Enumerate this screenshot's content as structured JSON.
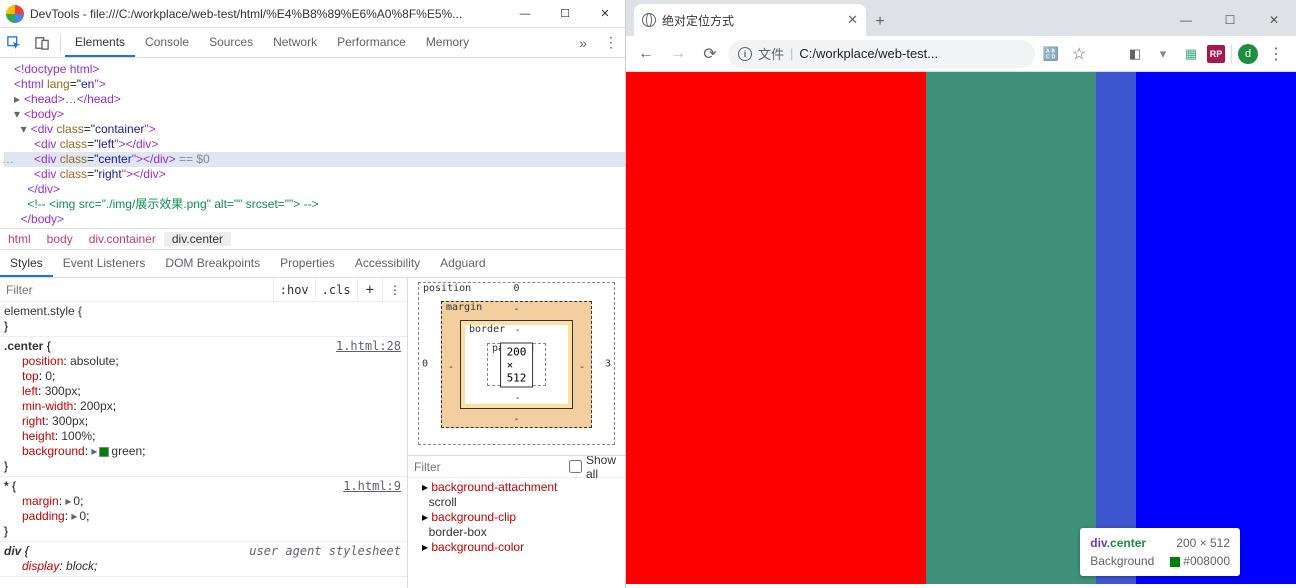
{
  "devtools": {
    "title": "DevTools - file:///C:/workplace/web-test/html/%E4%B8%89%E6%A0%8F%E5%...",
    "tabs": [
      "Elements",
      "Console",
      "Sources",
      "Network",
      "Performance",
      "Memory"
    ],
    "activeTab": "Elements",
    "dom": {
      "l0": "<!doctype html>",
      "l1a": "<",
      "l1b": "html",
      "l1c": " lang",
      "l1d": "=\"",
      "l1e": "en",
      "l1f": "\">",
      "l2a": "<",
      "l2b": "head",
      "l2c": ">…</",
      "l2d": "head",
      "l2e": ">",
      "l3a": "<",
      "l3b": "body",
      "l3c": ">",
      "l4a": "<",
      "l4b": "div",
      "l4c": " class",
      "l4d": "=\"",
      "l4e": "container",
      "l4f": "\">",
      "l5a": "<",
      "l5b": "div",
      "l5c": " class",
      "l5d": "=\"",
      "l5e": "left",
      "l5f": "\"></",
      "l5g": "div",
      "l5h": ">",
      "l6a": "<",
      "l6b": "div",
      "l6c": " class",
      "l6d": "=\"",
      "l6e": "center",
      "l6f": "\"></",
      "l6g": "div",
      "l6h": ">",
      "l6hint": " == $0",
      "l7a": "<",
      "l7b": "div",
      "l7c": " class",
      "l7d": "=\"",
      "l7e": "right",
      "l7f": "\"></",
      "l7g": "div",
      "l7h": ">",
      "l8a": "</",
      "l8b": "div",
      "l8c": ">",
      "l9": "<!-- <img src=\"./img/展示效果.png\" alt=\"\" srcset=\"\"> -->",
      "l10a": "</",
      "l10b": "body",
      "l10c": ">"
    },
    "crumbs": [
      "html",
      "body",
      "div.container",
      "div.center"
    ],
    "subtabs": [
      "Styles",
      "Event Listeners",
      "DOM Breakpoints",
      "Properties",
      "Accessibility",
      "Adguard"
    ],
    "activeSubtab": "Styles",
    "filter": {
      "placeholder": "Filter",
      "hov": ":hov",
      "cls": ".cls"
    },
    "rules": {
      "r0": {
        "sel": "element.style {",
        "close": "}"
      },
      "r1": {
        "src": "1.html:28",
        "sel": ".center",
        "open": " {",
        "p": [
          {
            "n": "position",
            "v": "absolute"
          },
          {
            "n": "top",
            "v": "0"
          },
          {
            "n": "left",
            "v": "300px"
          },
          {
            "n": "min-width",
            "v": "200px"
          },
          {
            "n": "right",
            "v": "300px"
          },
          {
            "n": "height",
            "v": "100%"
          },
          {
            "n": "background",
            "v": "green",
            "color": true
          }
        ],
        "close": "}"
      },
      "r2": {
        "src": "1.html:9",
        "sel": "*",
        "open": " {",
        "p": [
          {
            "n": "margin",
            "v": "0",
            "tri": true
          },
          {
            "n": "padding",
            "v": "0",
            "tri": true
          }
        ],
        "close": "}"
      },
      "r3": {
        "src": "user agent stylesheet",
        "sel": "div",
        "open": " {",
        "p": [
          {
            "n": "display",
            "v": "block"
          }
        ]
      }
    },
    "boxmodel": {
      "position": "position",
      "posT": "0",
      "posL": "0",
      "posR": "3",
      "margin": "margin",
      "mg": "-",
      "border": "border",
      "bd": "-",
      "padding": "padding",
      "pd": "-",
      "content": "200 × 512"
    },
    "cfilter": {
      "placeholder": "Filter",
      "showall": "Show all"
    },
    "computed": [
      {
        "n": "background-attachment",
        "v": "scroll"
      },
      {
        "n": "background-clip",
        "v": "border-box"
      },
      {
        "n": "background-color",
        "v": ""
      }
    ]
  },
  "browser": {
    "tabTitle": "绝对定位方式",
    "urlLabel": "文件",
    "url": "C:/workplace/web-test...",
    "avatar": "d",
    "ext_rp": "RP"
  },
  "tooltip": {
    "tag": "div",
    "cls": ".center",
    "dim": "200 × 512",
    "bgLabel": "Background",
    "bgVal": "#008000"
  }
}
